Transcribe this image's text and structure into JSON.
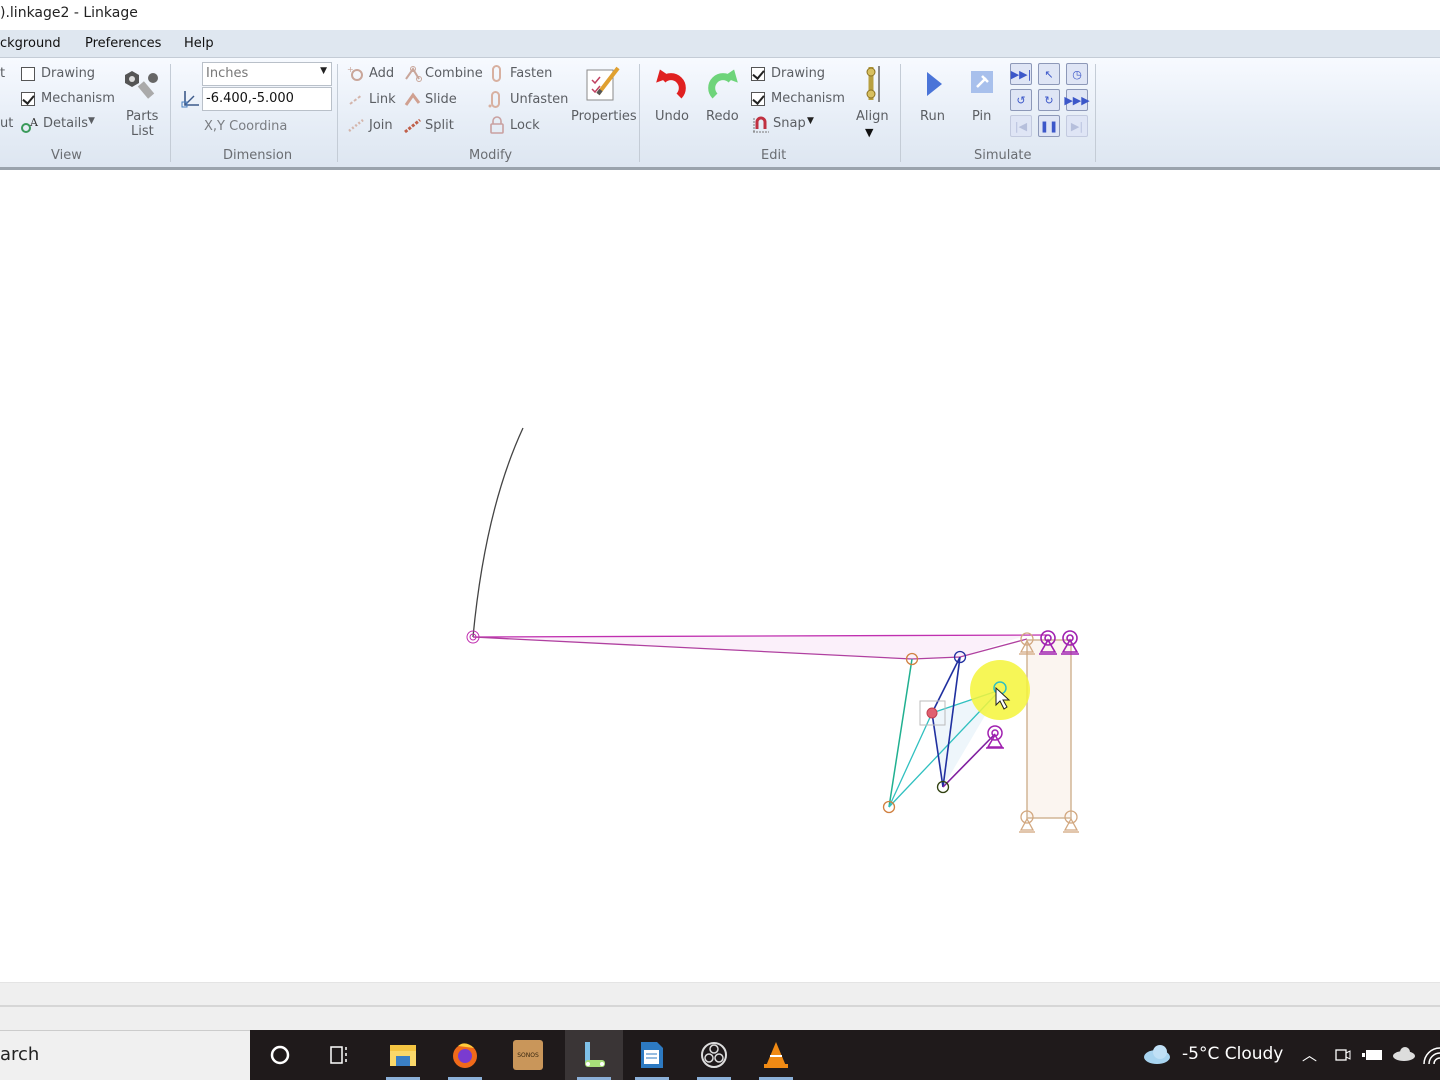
{
  "window": {
    "title": ").linkage2 - Linkage"
  },
  "menu": {
    "items": [
      "ckground",
      "Preferences",
      "Help"
    ]
  },
  "ribbon": {
    "view": {
      "group_label": "View",
      "partial_left_top": "t",
      "partial_left_bottom": "ut",
      "drawing_label": "Drawing",
      "drawing_checked": false,
      "mechanism_label": "Mechanism",
      "mechanism_checked": true,
      "details_label": "Details",
      "parts_list_label_1": "Parts",
      "parts_list_label_2": "List"
    },
    "dimension": {
      "group_label": "Dimension",
      "units_value": "Inches",
      "coord_value": "-6.400,-5.000",
      "coord_label": "X,Y Coordina"
    },
    "modify": {
      "group_label": "Modify",
      "add": "Add",
      "link": "Link",
      "join": "Join",
      "combine": "Combine",
      "slide": "Slide",
      "split": "Split",
      "fasten": "Fasten",
      "unfasten": "Unfasten",
      "lock": "Lock",
      "properties": "Properties"
    },
    "edit": {
      "group_label": "Edit",
      "undo": "Undo",
      "redo": "Redo",
      "drawing_label": "Drawing",
      "drawing_checked": true,
      "mechanism_label": "Mechanism",
      "mechanism_checked": true,
      "snap_label": "Snap",
      "align_label": "Align"
    },
    "simulate": {
      "group_label": "Simulate",
      "run": "Run",
      "pin": "Pin",
      "buttons": [
        {
          "name": "run-to-end",
          "glyph": "▶▶|",
          "enabled": true
        },
        {
          "name": "select-pointer",
          "glyph": "↖",
          "enabled": true
        },
        {
          "name": "timer",
          "glyph": "◷",
          "enabled": true
        },
        {
          "name": "rotate-ccw",
          "glyph": "↺",
          "enabled": true
        },
        {
          "name": "rotate-cw",
          "glyph": "↻",
          "enabled": true
        },
        {
          "name": "fast-forward",
          "glyph": "▶▶▶",
          "enabled": true
        },
        {
          "name": "step-back",
          "glyph": "|◀",
          "enabled": false
        },
        {
          "name": "pause",
          "glyph": "❚❚",
          "enabled": true
        },
        {
          "name": "step-forward",
          "glyph": "▶|",
          "enabled": false
        }
      ]
    }
  },
  "taskbar": {
    "search_text": "arch",
    "apps": [
      "cortana",
      "task-view",
      "file-explorer",
      "firefox",
      "sonos",
      "linkage",
      "libreoffice-writer",
      "obs-studio",
      "vlc"
    ],
    "sonos_label": "SONOS",
    "weather": "-5°C  Cloudy"
  }
}
